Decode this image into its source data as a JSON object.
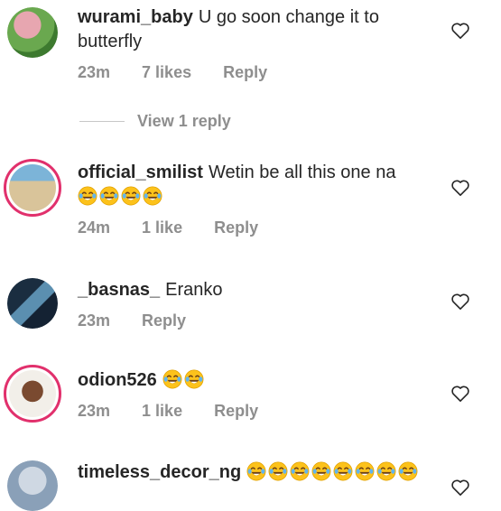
{
  "comments": [
    {
      "username": "wurami_baby",
      "text": "U go soon change it to butterfly",
      "emoji_count": 0,
      "time": "23m",
      "likes": "7 likes",
      "reply": "Reply",
      "has_ring": false,
      "view_replies": "View 1 reply"
    },
    {
      "username": "official_smilist",
      "text": "Wetin be all this one na",
      "emoji_count": 4,
      "time": "24m",
      "likes": "1 like",
      "reply": "Reply",
      "has_ring": true
    },
    {
      "username": "_basnas_",
      "text": "Eranko",
      "emoji_count": 0,
      "time": "23m",
      "likes": "",
      "reply": "Reply",
      "has_ring": false
    },
    {
      "username": "odion526",
      "text": "",
      "emoji_count": 2,
      "time": "23m",
      "likes": "1 like",
      "reply": "Reply",
      "has_ring": true
    },
    {
      "username": "timeless_decor_ng",
      "text": "",
      "emoji_count": 8,
      "has_ring": false
    }
  ],
  "icons": {
    "like": "heart-outline-icon",
    "emoji": "face-with-tears-of-joy-icon"
  },
  "colors": {
    "story_ring": "#e1306c",
    "secondary_text": "#8e8e8e"
  }
}
